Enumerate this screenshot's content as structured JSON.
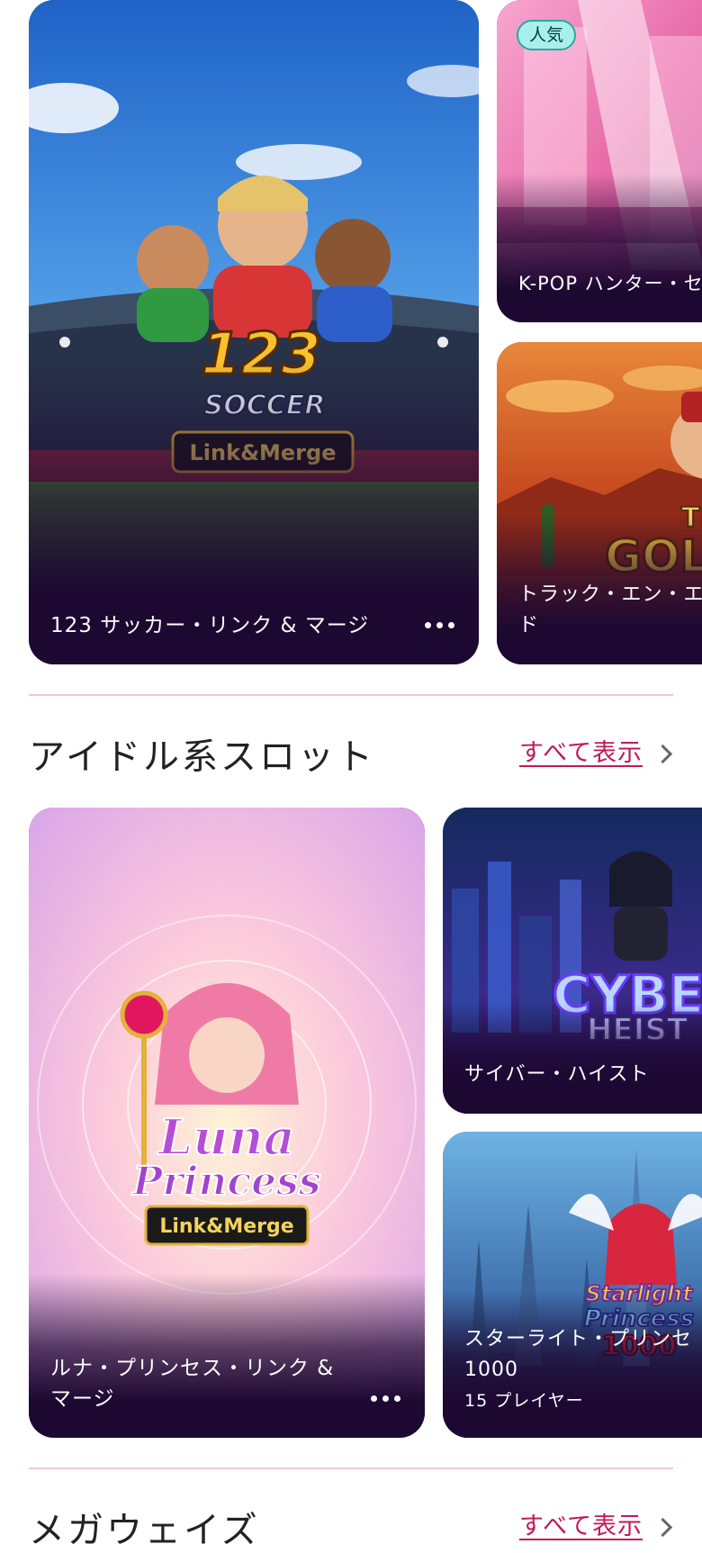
{
  "sections": [
    {
      "id": "featured",
      "cards": [
        {
          "title": "123 サッカー・リンク & マージ",
          "logo_lines": [
            "123",
            "SOCCER",
            "Link&Merge"
          ]
        },
        {
          "title": "K-POP ハンター・セ",
          "badge": "人気"
        },
        {
          "title": "トラック・エン・エ ド",
          "logo_lines": [
            "TRAC",
            "GOL"
          ]
        }
      ]
    },
    {
      "id": "idol-slots",
      "title": "アイドル系スロット",
      "see_all": "すべて表示",
      "cards": [
        {
          "title": "ルナ・プリンセス・リンク & マージ",
          "logo_lines": [
            "Luna",
            "Princess",
            "Link&Merge"
          ]
        },
        {
          "title": "サイバー・ハイスト",
          "logo_lines": [
            "CYBER",
            "HEIST"
          ]
        },
        {
          "title": "スターライト・プリンセ 1000",
          "players": "15 プレイヤー",
          "logo_lines": [
            "Starlight",
            "Princess",
            "1000"
          ]
        }
      ]
    },
    {
      "id": "megaways",
      "title": "メガウェイズ",
      "see_all": "すべて表示"
    }
  ],
  "colors": {
    "card_bg": "#1d0832",
    "accent_link": "#c2185b",
    "divider": "#f2c6d3",
    "badge_bg": "#a8f0ec"
  },
  "icons": [
    "more-dots-icon",
    "chevron-right-icon"
  ]
}
